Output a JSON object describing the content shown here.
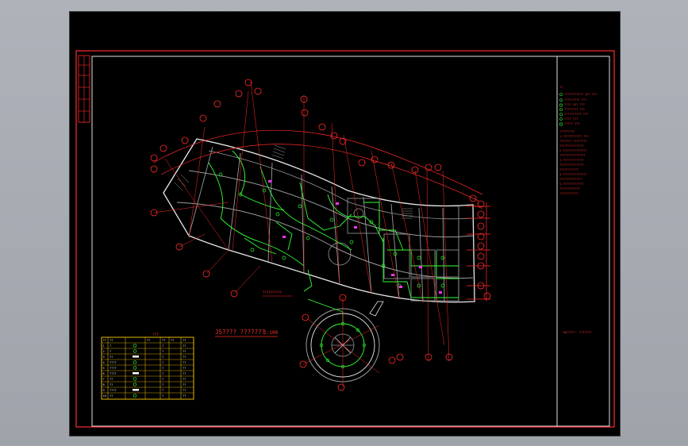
{
  "drawing": {
    "plan_title": "JS???? ???????",
    "scale": "1:100",
    "stamp_text": "??????????",
    "footer_label": "?ю?????- ???????",
    "legend_table": {
      "title": "???",
      "header": [
        "??",
        "??",
        "??",
        "??",
        "??",
        "??"
      ],
      "rows": [
        [
          "1",
          "?",
          "",
          "?",
          "",
          "??"
        ],
        [
          "2",
          "?",
          "",
          "?",
          "",
          "??"
        ],
        [
          "3",
          "??",
          "",
          "?",
          "",
          "??"
        ],
        [
          "4",
          "????",
          "",
          "?",
          "",
          "??"
        ],
        [
          "5",
          "????",
          "",
          "?",
          "",
          "??"
        ],
        [
          "6",
          "????",
          "",
          "?",
          "",
          "??"
        ],
        [
          "7",
          "??",
          "",
          "?",
          "",
          "??"
        ],
        [
          "8",
          "??",
          "",
          "?",
          "",
          "??"
        ],
        [
          "9",
          "????",
          "",
          "?",
          "",
          "??"
        ],
        [
          "10",
          "??",
          "",
          "?",
          "",
          "??"
        ]
      ]
    },
    "notes": {
      "heading": "??",
      "items": [
        "??????????? 12?  ???",
        "????????? ???",
        "???? 12?  ???",
        "???????? ???",
        "?????????? ???",
        "???? ???",
        "????? ???"
      ],
      "sub_heading": "?????????",
      "paragraph": [
        "1.??????????? ???",
        "  ??????? ????????",
        "  ??????????????",
        "2.??????????????",
        "  ???????????????",
        "3.????????????",
        "  ??????????????",
        "  ???????????",
        "4.??????????????",
        "  ?????????????",
        "5.????????????",
        "  ????????????",
        "  ???????????"
      ]
    }
  }
}
